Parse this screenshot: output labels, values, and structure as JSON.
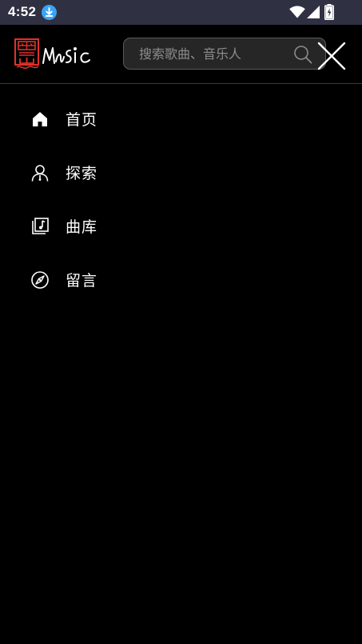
{
  "status_bar": {
    "time": "4:52"
  },
  "header": {
    "logo_seal_text": "黑山",
    "logo_brand_text": "MUSIC",
    "search": {
      "placeholder": "搜索歌曲、音乐人",
      "value": ""
    }
  },
  "menu": {
    "items": [
      {
        "label": "首页",
        "icon": "home-icon"
      },
      {
        "label": "探索",
        "icon": "person-icon"
      },
      {
        "label": "曲库",
        "icon": "music-library-icon"
      },
      {
        "label": "留言",
        "icon": "compass-icon"
      }
    ]
  },
  "colors": {
    "status_bar_bg": "#2f3142",
    "background": "#000000",
    "logo_red": "#e0312a",
    "download_badge": "#3aa3f5",
    "search_bg": "#262626",
    "search_border": "#5a5a5a",
    "placeholder": "#8c8c8c"
  }
}
